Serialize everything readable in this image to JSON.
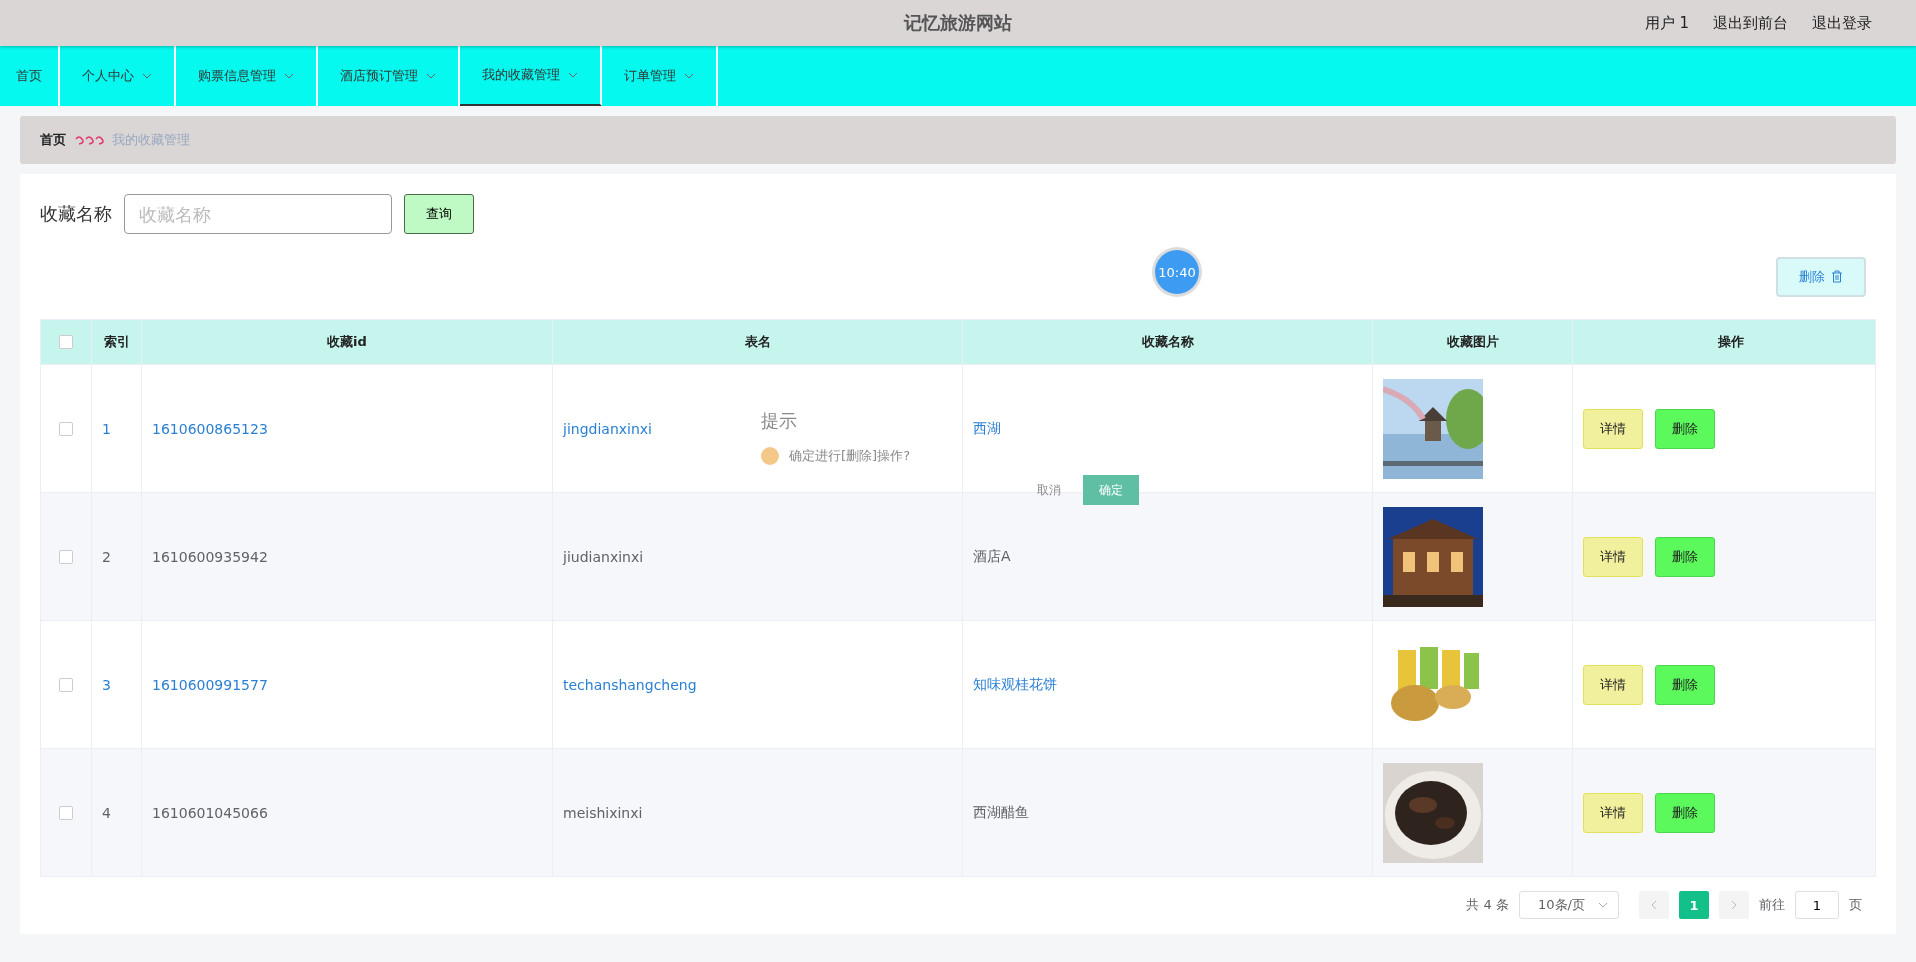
{
  "header": {
    "title": "记忆旅游网站",
    "links": [
      "用户 1",
      "退出到前台",
      "退出登录"
    ]
  },
  "nav": [
    {
      "label": "首页",
      "dropdown": false,
      "selected": false
    },
    {
      "label": "个人中心",
      "dropdown": true,
      "selected": false
    },
    {
      "label": "购票信息管理",
      "dropdown": true,
      "selected": false
    },
    {
      "label": "酒店预订管理",
      "dropdown": true,
      "selected": false
    },
    {
      "label": "我的收藏管理",
      "dropdown": true,
      "selected": true
    },
    {
      "label": "订单管理",
      "dropdown": true,
      "selected": false
    }
  ],
  "breadcrumb": {
    "home": "首页",
    "current": "我的收藏管理"
  },
  "search": {
    "label": "收藏名称",
    "placeholder": "收藏名称",
    "button": "查询"
  },
  "clock_badge": "10:40",
  "delete_button": "删除",
  "table": {
    "columns": [
      "索引",
      "收藏id",
      "表名",
      "收藏名称",
      "收藏图片",
      "操作"
    ],
    "select_all_checked": false,
    "rows": [
      {
        "index": "1",
        "id": "1610600865123",
        "table": "jingdianxinxi",
        "name": "西湖",
        "highlighted": true,
        "checked": false,
        "picture": {
          "kind": "picture"
        },
        "actions": [
          "详情",
          "删除"
        ]
      },
      {
        "index": "2",
        "id": "1610600935942",
        "table": "jiudianxinxi",
        "name": "酒店A",
        "highlighted": false,
        "checked": false,
        "picture": {
          "kind": "picture"
        },
        "actions": [
          "详情",
          "删除"
        ]
      },
      {
        "index": "3",
        "id": "1610600991577",
        "table": "techanshangcheng",
        "name": "知味观桂花饼",
        "highlighted": true,
        "checked": false,
        "picture": {
          "kind": "picture"
        },
        "actions": [
          "详情",
          "删除"
        ]
      },
      {
        "index": "4",
        "id": "1610601045066",
        "table": "meishixinxi",
        "name": "西湖醋鱼",
        "highlighted": false,
        "checked": false,
        "picture": {
          "kind": "picture"
        },
        "actions": [
          "详情",
          "删除"
        ]
      }
    ]
  },
  "dialog": {
    "title": "提示",
    "message": "确定进行[删除]操作?",
    "buttons": [
      "取消",
      "确定"
    ]
  },
  "pagination": {
    "total": "共 4 条",
    "page_size": "10条/页",
    "pages": [
      {
        "label": "1",
        "selected": true
      }
    ],
    "goto_label": "前往",
    "goto_value": "1",
    "goto_suffix": "页"
  }
}
